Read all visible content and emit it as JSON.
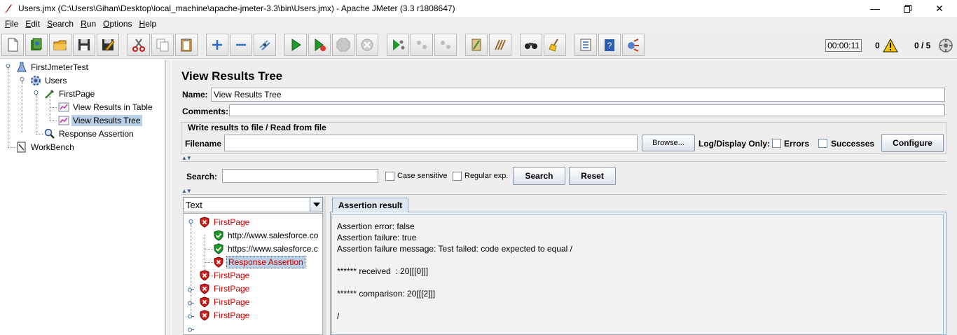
{
  "window": {
    "title": "Users.jmx (C:\\Users\\Gihan\\Desktop\\local_machine\\apache-jmeter-3.3\\bin\\Users.jmx) - Apache JMeter (3.3 r1808647)",
    "minimize": "—",
    "maximize": "❐",
    "close": "✕"
  },
  "menu": [
    {
      "label": "File",
      "u": "F",
      "rest": "ile"
    },
    {
      "label": "Edit",
      "u": "E",
      "rest": "dit"
    },
    {
      "label": "Search",
      "u": "S",
      "rest": "earch"
    },
    {
      "label": "Run",
      "u": "R",
      "rest": "un"
    },
    {
      "label": "Options",
      "u": "O",
      "rest": "ptions"
    },
    {
      "label": "Help",
      "u": "H",
      "rest": "elp"
    }
  ],
  "toolbar": {
    "timer": "00:00:11",
    "error_count": "0",
    "threads": "0 / 5",
    "buttons": [
      "new-icon",
      "templates-icon",
      "open-icon",
      "save-icon",
      "save-as-icon",
      "cut-icon",
      "copy-icon",
      "paste-icon",
      "expand-icon",
      "collapse-icon",
      "toggle-icon",
      "start-icon",
      "start-no-pause-icon",
      "stop-icon",
      "shutdown-icon",
      "remote-start-icon",
      "remote-stop-icon",
      "remote-shutdown-icon",
      "clear-icon",
      "clear-all-icon",
      "search-icon",
      "reset-search-icon",
      "function-helper-icon",
      "help-icon",
      "remote-start-all-icon"
    ]
  },
  "test_tree": {
    "items": [
      {
        "label": "FirstJmeterTest"
      },
      {
        "label": "Users"
      },
      {
        "label": "FirstPage"
      },
      {
        "label": "View Results in Table"
      },
      {
        "label": "View Results Tree"
      },
      {
        "label": "Response Assertion"
      },
      {
        "label": "WorkBench"
      }
    ]
  },
  "panel": {
    "title": "View Results Tree",
    "name_label": "Name:",
    "name_value": "View Results Tree",
    "comments_label": "Comments:",
    "comments_value": "",
    "file_group_label": "Write results to file / Read from file",
    "filename_label": "Filename",
    "filename_value": "",
    "browse_label": "Browse...",
    "log_display_label": "Log/Display Only:",
    "errors_label": "Errors",
    "successes_label": "Successes",
    "configure_label": "Configure",
    "search_label": "Search:",
    "search_value": "",
    "case_sensitive_label": "Case sensitive",
    "regex_label": "Regular exp.",
    "search_button": "Search",
    "reset_button": "Reset"
  },
  "results": {
    "renderer": "Text",
    "items": [
      {
        "label": "FirstPage",
        "status": "fail"
      },
      {
        "label": "http://www.salesforce.co",
        "status": "ok"
      },
      {
        "label": "https://www.salesforce.c",
        "status": "ok"
      },
      {
        "label": "Response Assertion",
        "status": "fail"
      },
      {
        "label": "FirstPage",
        "status": "fail"
      },
      {
        "label": "FirstPage",
        "status": "fail"
      },
      {
        "label": "FirstPage",
        "status": "fail"
      },
      {
        "label": "FirstPage",
        "status": "fail"
      }
    ]
  },
  "assertion": {
    "tab_label": "Assertion result",
    "lines": [
      "Assertion error: false",
      "Assertion failure: true",
      "Assertion failure message: Test failed: code expected to equal /",
      "****** received  : 20[[[0]]]",
      "****** comparison: 20[[[2]]]",
      "/"
    ]
  },
  "colors": {
    "fail": "#cc0000",
    "selection": "#b8cfe5",
    "panel_bg": "#eeeeee"
  }
}
